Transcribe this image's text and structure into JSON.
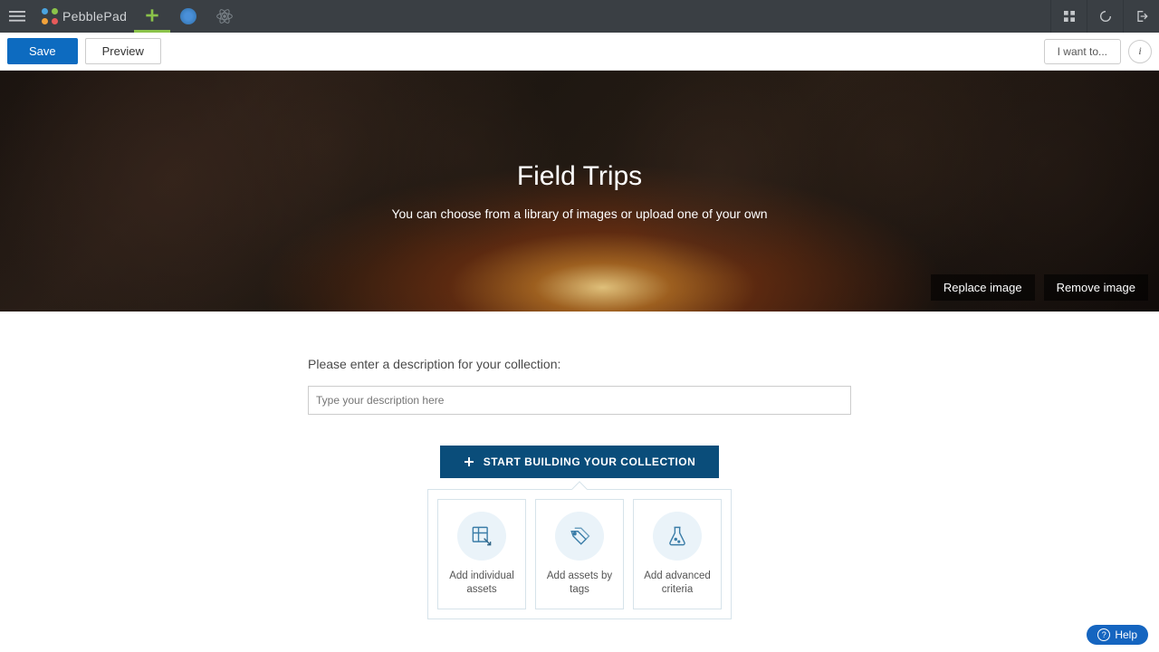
{
  "topbar": {
    "brand": "PebblePad"
  },
  "actionbar": {
    "save": "Save",
    "preview": "Preview",
    "iwant": "I want to...",
    "info": "i"
  },
  "banner": {
    "title": "Field Trips",
    "subtitle": "You can choose from a library of images or upload one of your own",
    "replace": "Replace image",
    "remove": "Remove image"
  },
  "description": {
    "label": "Please enter a description for your collection:",
    "placeholder": "Type your description here"
  },
  "build_button": "START BUILDING YOUR COLLECTION",
  "cards": [
    {
      "label": "Add individual assets"
    },
    {
      "label": "Add assets by tags"
    },
    {
      "label": "Add advanced criteria"
    }
  ],
  "help": "Help"
}
